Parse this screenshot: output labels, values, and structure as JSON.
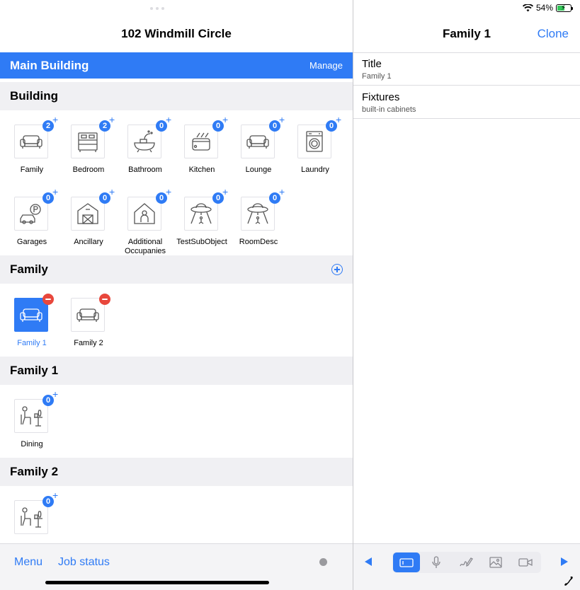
{
  "left": {
    "title": "102 Windmill Circle",
    "blue_bar": {
      "title": "Main Building",
      "manage": "Manage"
    },
    "sections": {
      "building": {
        "title": "Building",
        "tiles": [
          {
            "label": "Family",
            "count": "2",
            "icon": "sofa-icon"
          },
          {
            "label": "Bedroom",
            "count": "2",
            "icon": "bed-icon"
          },
          {
            "label": "Bathroom",
            "count": "0",
            "icon": "bathtub-icon"
          },
          {
            "label": "Kitchen",
            "count": "0",
            "icon": "toaster-icon"
          },
          {
            "label": "Lounge",
            "count": "0",
            "icon": "sofa-icon"
          },
          {
            "label": "Laundry",
            "count": "0",
            "icon": "washing-machine-icon"
          },
          {
            "label": "Garages",
            "count": "0",
            "icon": "car-parking-icon"
          },
          {
            "label": "Ancillary",
            "count": "0",
            "icon": "barn-icon"
          },
          {
            "label": "Additional Occupanies",
            "count": "0",
            "icon": "house-person-icon"
          },
          {
            "label": "TestSubObject",
            "count": "0",
            "icon": "ufo-icon"
          },
          {
            "label": "RoomDesc",
            "count": "0",
            "icon": "ufo-icon"
          }
        ]
      },
      "family": {
        "title": "Family",
        "items": [
          {
            "label": "Family 1",
            "selected": true
          },
          {
            "label": "Family 2",
            "selected": false
          }
        ]
      },
      "family1": {
        "title": "Family 1",
        "tiles": [
          {
            "label": "Dining",
            "count": "0",
            "icon": "dining-icon"
          }
        ]
      },
      "family2": {
        "title": "Family 2",
        "tiles": [
          {
            "label": "",
            "count": "0",
            "icon": "dining-icon"
          }
        ]
      }
    },
    "bottom": {
      "menu": "Menu",
      "job_status": "Job status"
    }
  },
  "right": {
    "status": {
      "battery": "54%",
      "battery_level": 0.54
    },
    "title": "Family 1",
    "clone": "Clone",
    "fields": [
      {
        "label": "Title",
        "value": "Family 1"
      },
      {
        "label": "Fixtures",
        "value": "built-in cabinets"
      }
    ]
  },
  "colors": {
    "accent": "#2f7bf5",
    "remove": "#e8473c",
    "section_bg": "#f0f0f3"
  }
}
